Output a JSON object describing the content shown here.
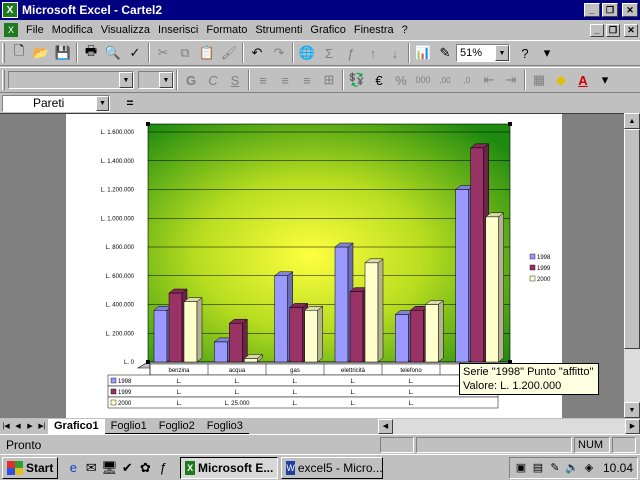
{
  "window": {
    "title": "Microsoft Excel - Cartel2"
  },
  "menu": [
    "File",
    "Modifica",
    "Visualizza",
    "Inserisci",
    "Formato",
    "Strumenti",
    "Grafico",
    "Finestra",
    "?"
  ],
  "toolbar": {
    "zoom": "51%",
    "help": "?"
  },
  "formula_bar": {
    "name_box": "Pareti",
    "equals": "="
  },
  "chart_data": {
    "type": "bar",
    "categories": [
      "benzina",
      "acqua",
      "gas",
      "elettricità",
      "telefono",
      "affitto"
    ],
    "series": [
      {
        "name": "1998",
        "values": [
          360000,
          140000,
          600000,
          800000,
          330000,
          1200000
        ],
        "color": "#9999ff"
      },
      {
        "name": "1999",
        "values": [
          480000,
          270000,
          380000,
          490000,
          360000,
          1490000
        ],
        "color": "#993366"
      },
      {
        "name": "2000",
        "values": [
          420000,
          25000,
          360000,
          690000,
          400000,
          1010000
        ],
        "color": "#ffffcc"
      }
    ],
    "y_ticks": [
      "L. 1.600.000",
      "L. 1.400.000",
      "L. 1.200.000",
      "L. 1.000.000",
      "L. 800.000",
      "L. 600.000",
      "L. 400.000",
      "L. 200.000",
      "L. 0"
    ],
    "ylim": [
      0,
      1600000
    ],
    "legend_position": "right",
    "legend": [
      "1998",
      "1999",
      "2000"
    ],
    "table_rows": [
      {
        "series": "1998",
        "cells": [
          "L.",
          "L.",
          "L.",
          "L.",
          "L.",
          ""
        ]
      },
      {
        "series": "1999",
        "cells": [
          "L.",
          "L.",
          "L.",
          "L.",
          "L.",
          ""
        ]
      },
      {
        "series": "2000",
        "cells": [
          "L.",
          "L. 25.000",
          "L.",
          "L.",
          "L.",
          ""
        ]
      }
    ]
  },
  "tooltip": {
    "line1": "Serie \"1998\" Punto \"affitto\"",
    "line2": "Valore: L. 1.200.000"
  },
  "sheet_tabs": [
    "Grafico1",
    "Foglio1",
    "Foglio2",
    "Foglio3"
  ],
  "status": {
    "text": "Pronto",
    "num": "NUM"
  },
  "taskbar": {
    "start": "Start",
    "tasks": [
      "Microsoft E...",
      "excel5 - Micro..."
    ],
    "clock": "10.04"
  }
}
